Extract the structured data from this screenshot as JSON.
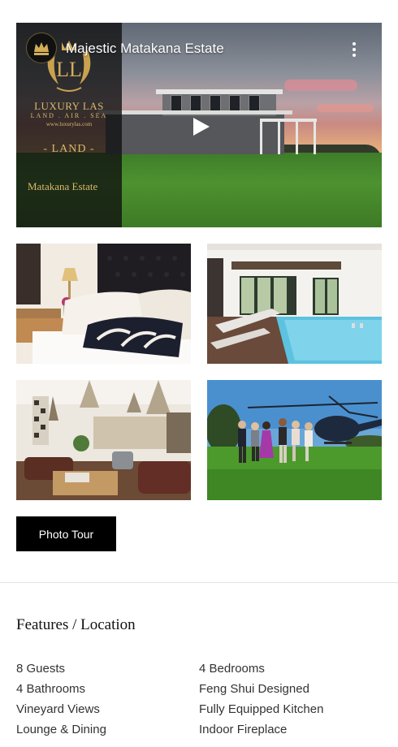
{
  "video": {
    "title": "Majestic Matakana Estate",
    "brand": {
      "name": "LUXURY LAS",
      "tagline": "LAND . AIR . SEA",
      "url": "www.luxurylas.com",
      "category": "- LAND -",
      "caption": "Matakana Estate"
    }
  },
  "gallery": {
    "photos": [
      "bedroom",
      "indoor-pool",
      "lounge",
      "helicopter-arrival"
    ]
  },
  "photo_tour_button": "Photo Tour",
  "features_section": {
    "title": "Features / Location",
    "left": [
      "8 Guests",
      "4 Bathrooms",
      "Vineyard Views",
      "Lounge & Dining"
    ],
    "right": [
      "4 Bedrooms",
      "Feng Shui Designed",
      "Fully Equipped Kitchen",
      "Indoor Fireplace"
    ]
  }
}
